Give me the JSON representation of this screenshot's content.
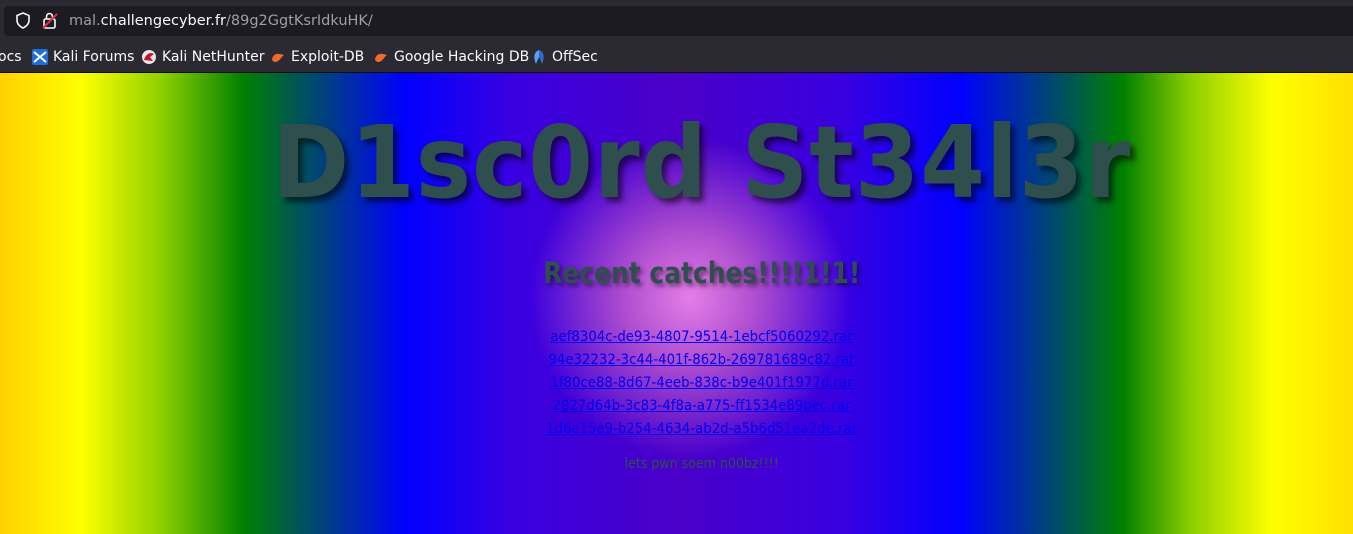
{
  "browser": {
    "url_host_prefix": "mal.",
    "url_host_main": "challengecyber.fr",
    "url_path": "/89g2GgtKsrIdkuHK/",
    "bookmarks": [
      {
        "label": "ocs",
        "icon": "docs-icon"
      },
      {
        "label": "Kali Forums",
        "icon": "kali-forums-icon"
      },
      {
        "label": "Kali NetHunter",
        "icon": "kali-nethunter-icon"
      },
      {
        "label": "Exploit-DB",
        "icon": "exploit-db-icon"
      },
      {
        "label": "Google Hacking DB",
        "icon": "google-hacking-db-icon"
      },
      {
        "label": "OffSec",
        "icon": "offsec-icon"
      }
    ]
  },
  "page": {
    "title": "D1sc0rd St34l3r",
    "subtitle": "Recent catches!!!!1!1!",
    "files": [
      "aef8304c-de93-4807-9514-1ebcf5060292.rar",
      "94e32232-3c44-401f-862b-269781689c82.rar",
      "1f80ce88-8d67-4eeb-838c-b9e401f1977d.rar",
      "2827d64b-3c83-4f8a-a775-ff1534e89bec.rar",
      "1d6e15e9-b254-4634-ab2d-a5b6d51ea2de.rar"
    ],
    "footer": "lets pwn soem n00bz!!!!"
  },
  "colors": {
    "heading": "#2f4f4f",
    "link": "#0000ee",
    "browser_chrome": "#2b2a33"
  }
}
